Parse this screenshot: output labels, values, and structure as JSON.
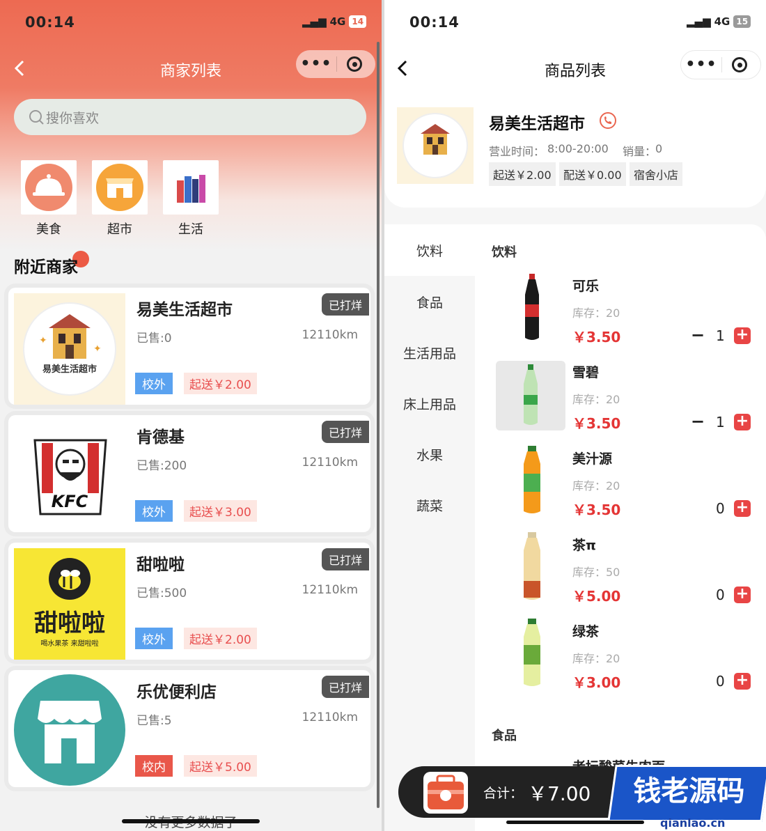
{
  "left": {
    "status": {
      "time": "00:14",
      "network": "4G",
      "battery": "14"
    },
    "nav": {
      "title": "商家列表"
    },
    "search": {
      "placeholder": "搜你喜欢"
    },
    "categories": [
      {
        "label": "美食"
      },
      {
        "label": "超市"
      },
      {
        "label": "生活"
      }
    ],
    "section_title": "附近商家",
    "shops": [
      {
        "name": "易美生活超市",
        "logo_text": "易美生活超市",
        "sold": "已售:0",
        "distance": "12110km",
        "status": "已打烊",
        "area": "校外",
        "min_order": "起送￥2.00"
      },
      {
        "name": "肯德基",
        "logo_text": "KFC",
        "sold": "已售:200",
        "distance": "12110km",
        "status": "已打烊",
        "area": "校外",
        "min_order": "起送￥3.00"
      },
      {
        "name": "甜啦啦",
        "logo_text": "甜啦啦",
        "logo_subtext": "喝水果茶 来甜啦啦",
        "sold": "已售:500",
        "distance": "12110km",
        "status": "已打烊",
        "area": "校外",
        "min_order": "起送￥2.00"
      },
      {
        "name": "乐优便利店",
        "sold": "已售:5",
        "distance": "12110km",
        "status": "已打烊",
        "area": "校内",
        "min_order": "起送￥5.00"
      }
    ],
    "footer": "没有更多数据了"
  },
  "right": {
    "status": {
      "time": "00:14",
      "network": "4G",
      "battery": "15"
    },
    "nav": {
      "title": "商品列表"
    },
    "store": {
      "name": "易美生活超市",
      "hours_label": "营业时间：",
      "hours": "8:00-20:00",
      "sales_label": "销量：",
      "sales": "0",
      "pills": [
        "起送￥2.00",
        "配送￥0.00",
        "宿舍小店"
      ]
    },
    "side_categories": [
      "饮料",
      "食品",
      "生活用品",
      "床上用品",
      "水果",
      "蔬菜"
    ],
    "active_category": "饮料",
    "section_title": "饮料",
    "products": [
      {
        "name": "可乐",
        "stock": "库存：20",
        "price": "￥3.50",
        "qty": "1"
      },
      {
        "name": "雪碧",
        "stock": "库存：20",
        "price": "￥3.50",
        "qty": "1"
      },
      {
        "name": "美汁源",
        "stock": "库存：20",
        "price": "￥3.50",
        "qty": "0"
      },
      {
        "name": "茶π",
        "stock": "库存：50",
        "price": "￥5.00",
        "qty": "0"
      },
      {
        "name": "绿茶",
        "stock": "库存：20",
        "price": "￥3.00",
        "qty": "0"
      }
    ],
    "next_section_title": "食品",
    "next_product_name": "老坛酸菜牛肉面",
    "cart": {
      "total_label": "合计：",
      "total": "￥7.00"
    },
    "watermark": {
      "title": "钱老源码",
      "url": "qianlao.cn"
    }
  },
  "colors": {
    "brand_red": "#ea6650",
    "price_red": "#e43535",
    "tag_blue": "#5aa2f0",
    "tag_red": "#e9574a"
  }
}
